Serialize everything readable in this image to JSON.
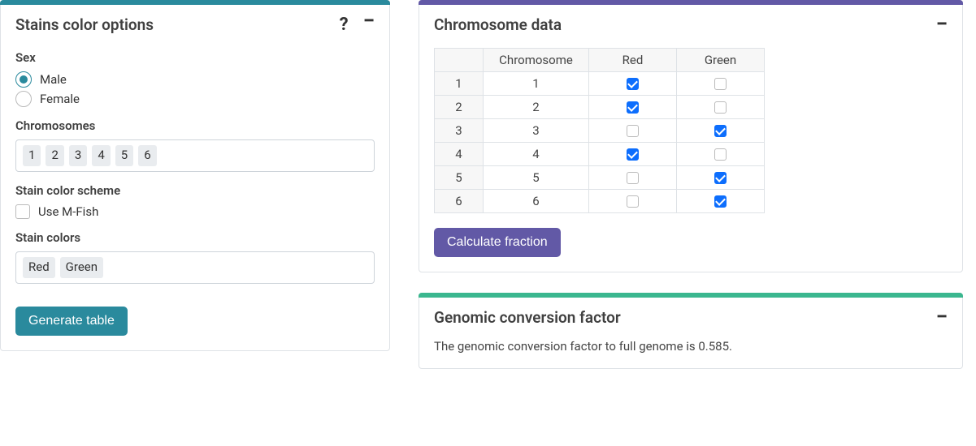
{
  "left_panel": {
    "title": "Stains color options",
    "sex_label": "Sex",
    "sex_options": {
      "male": "Male",
      "female": "Female"
    },
    "sex_selected": "male",
    "chrom_label": "Chromosomes",
    "chromosomes": [
      "1",
      "2",
      "3",
      "4",
      "5",
      "6"
    ],
    "scheme_label": "Stain color scheme",
    "mfish_label": "Use M-Fish",
    "mfish_checked": false,
    "colors_label": "Stain colors",
    "stain_colors": [
      "Red",
      "Green"
    ],
    "generate_btn": "Generate table"
  },
  "chrom_panel": {
    "title": "Chromosome data",
    "headers": {
      "chrom": "Chromosome"
    },
    "stain_headers": [
      "Red",
      "Green"
    ],
    "rows": [
      {
        "n": "1",
        "chrom": "1",
        "stains": [
          true,
          false
        ]
      },
      {
        "n": "2",
        "chrom": "2",
        "stains": [
          true,
          false
        ]
      },
      {
        "n": "3",
        "chrom": "3",
        "stains": [
          false,
          true
        ]
      },
      {
        "n": "4",
        "chrom": "4",
        "stains": [
          true,
          false
        ]
      },
      {
        "n": "5",
        "chrom": "5",
        "stains": [
          false,
          true
        ]
      },
      {
        "n": "6",
        "chrom": "6",
        "stains": [
          false,
          true
        ]
      }
    ],
    "calc_btn": "Calculate fraction"
  },
  "genomic_panel": {
    "title": "Genomic conversion factor",
    "text_prefix": "The genomic conversion factor to full genome is ",
    "value": "0.585",
    "text_suffix": "."
  }
}
